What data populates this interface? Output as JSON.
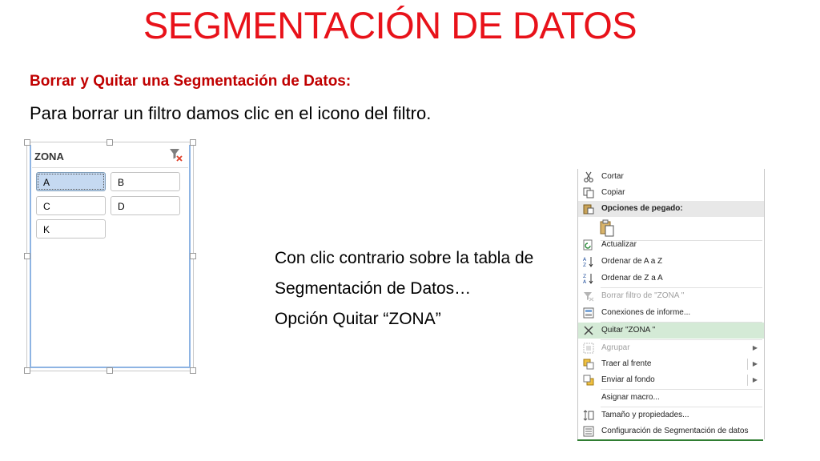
{
  "slide": {
    "title": "SEGMENTACIÓN DE DATOS",
    "subtitle": "Borrar y Quitar una Segmentación de Datos:",
    "paragraph": "Para borrar un filtro  damos clic en el icono del filtro.",
    "side_lines": [
      "Con clic contrario sobre la tabla de",
      "Segmentación de Datos…",
      "Opción Quitar “ZONA”"
    ]
  },
  "slicer": {
    "header": "ZONA",
    "items": [
      {
        "label": "A",
        "selected": true
      },
      {
        "label": "B",
        "selected": false
      },
      {
        "label": "C",
        "selected": false
      },
      {
        "label": "D",
        "selected": false
      },
      {
        "label": "K",
        "selected": false
      }
    ]
  },
  "context_menu": {
    "items": [
      {
        "label": "Cortar",
        "icon": "scissors-icon"
      },
      {
        "label": "Copiar",
        "icon": "copy-icon"
      },
      {
        "label": "Opciones de pegado:",
        "icon": "paste-icon"
      },
      {
        "label": "",
        "icon": "paste-option-icon"
      },
      {
        "label": "Actualizar",
        "icon": "refresh-icon"
      },
      {
        "label": "Ordenar de A a Z",
        "icon": "sort-az-icon"
      },
      {
        "label": "Ordenar de Z a A",
        "icon": "sort-za-icon"
      },
      {
        "label": "Borrar filtro de \"ZONA \"",
        "icon": "clear-filter-icon"
      },
      {
        "label": "Conexiones de informe...",
        "icon": "connections-icon"
      },
      {
        "label": "Quitar \"ZONA \"",
        "icon": "remove-x-icon"
      },
      {
        "label": "Agrupar",
        "icon": "group-icon"
      },
      {
        "label": "Traer al frente",
        "icon": "bring-front-icon"
      },
      {
        "label": "Enviar al fondo",
        "icon": "send-back-icon"
      },
      {
        "label": "Asignar macro...",
        "icon": ""
      },
      {
        "label": "Tamaño y propiedades...",
        "icon": "size-properties-icon"
      },
      {
        "label": "Configuración de Segmentación de datos",
        "icon": "slicer-settings-icon"
      }
    ]
  }
}
